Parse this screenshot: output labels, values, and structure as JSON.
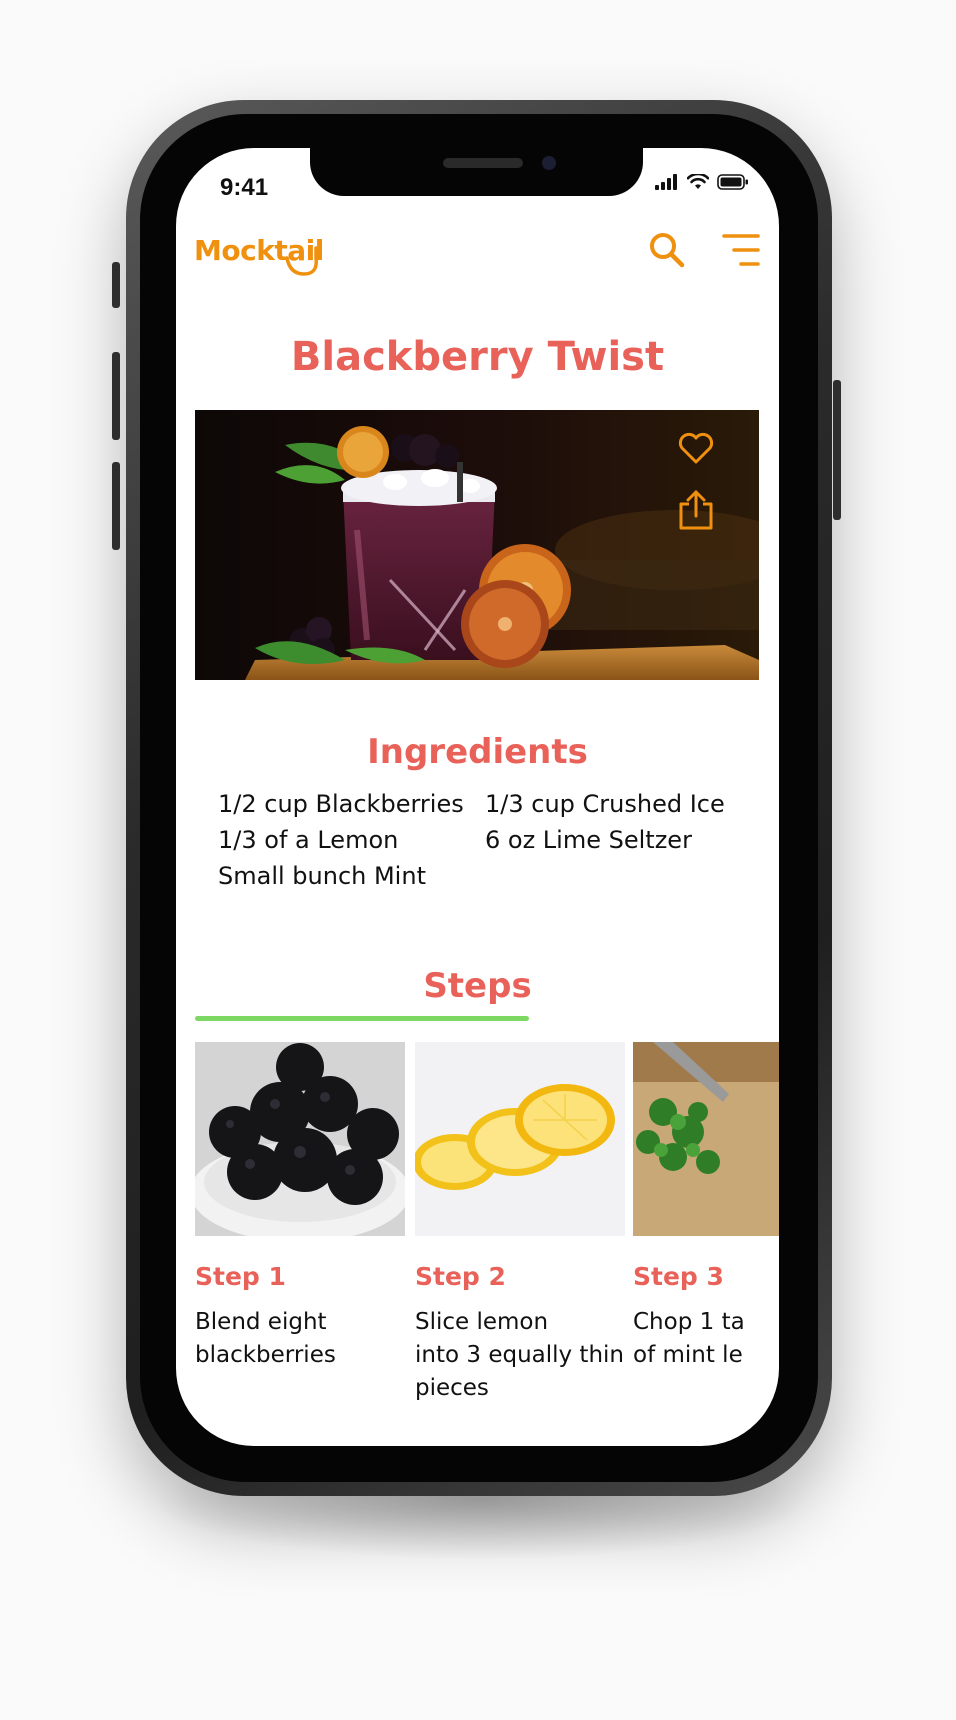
{
  "status_bar": {
    "time": "9:41"
  },
  "header": {
    "logo_text": "Mocktail"
  },
  "recipe": {
    "title": "Blackberry Twist",
    "hero_alt": "Blackberry mocktail in a glass with crushed ice, mint and dried orange slices"
  },
  "ingredients": {
    "heading": "Ingredients",
    "items": [
      "1/2 cup Blackberries",
      "1/3 cup Crushed Ice",
      "1/3 of a Lemon",
      "6 oz Lime Seltzer",
      "Small bunch Mint"
    ]
  },
  "steps": {
    "heading": "Steps",
    "items": [
      {
        "label": "Step 1",
        "lines": [
          "Blend eight",
          "blackberries"
        ]
      },
      {
        "label": "Step 2",
        "lines": [
          "Slice lemon",
          "into 3 equally thin",
          "pieces"
        ]
      },
      {
        "label": "Step 3",
        "lines": [
          "Chop 1 ta",
          "of mint le"
        ]
      }
    ]
  },
  "colors": {
    "accent": "#f0900f",
    "title": "#e8625a",
    "underline": "#7dd863"
  }
}
